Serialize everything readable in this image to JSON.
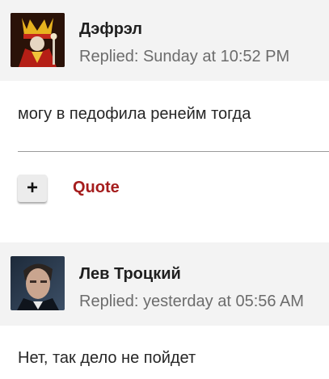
{
  "colors": {
    "header_bg": "#f3f3f3",
    "quote_red": "#a51d1d",
    "meta_gray": "#6c6c6c"
  },
  "posts": [
    {
      "author": "Дэфрэл",
      "replied_label": "Replied:",
      "replied_time": "Sunday at 10:52 PM",
      "body": "могу в педофила ренейм тогда",
      "avatar_icon": "jester-avatar-icon",
      "actions": {
        "add_icon": "plus-icon",
        "add_label": "+",
        "quote_label": "Quote"
      }
    },
    {
      "author": "Лев Троцкий",
      "replied_label": "Replied:",
      "replied_time": "yesterday at 05:56 AM",
      "body": "Нет, так дело не пойдет",
      "avatar_icon": "man-portrait-avatar-icon"
    }
  ]
}
